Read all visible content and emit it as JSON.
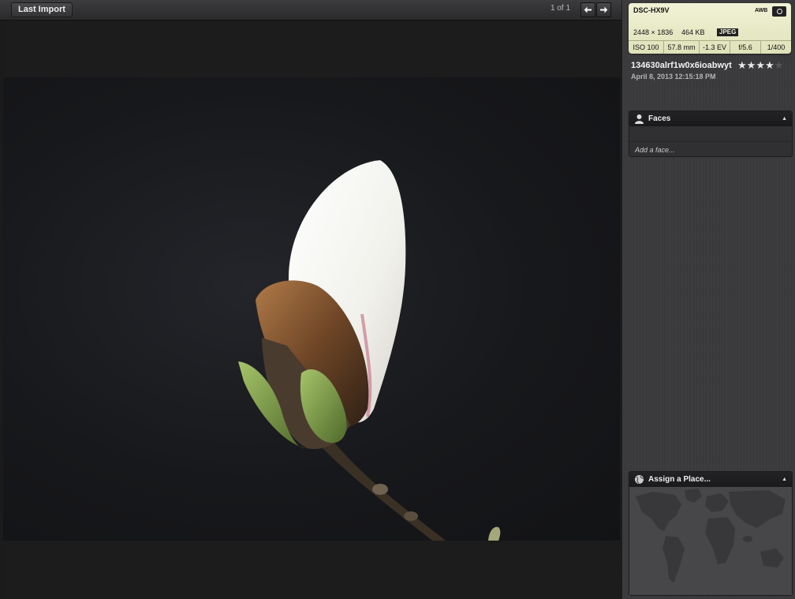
{
  "toolbar": {
    "back_label": "Last Import",
    "counter": "1 of 1",
    "prev_icon": "arrow-left-icon",
    "next_icon": "arrow-right-icon"
  },
  "info": {
    "camera_model": "DSC-HX9V",
    "white_balance": "AWB",
    "metering_icon": "metering-icon",
    "dimensions": "2448 × 1836",
    "file_size": "464 KB",
    "format": "JPEG",
    "iso": "ISO 100",
    "focal_length": "57.8 mm",
    "exposure_bias": "-1.3 EV",
    "aperture": "f/5.6",
    "shutter": "1/400"
  },
  "photo": {
    "title": "134630alrf1w0x6ioabwyt",
    "date": "April 8, 2013 12:15:18 PM",
    "rating": 4,
    "rating_max": 5,
    "star_glyph": "★"
  },
  "faces": {
    "header": "Faces",
    "placeholder": "Add a face...",
    "icon": "person-icon"
  },
  "places": {
    "header": "Assign a Place...",
    "icon": "globe-icon"
  },
  "colors": {
    "info_card_bg": "#eceecc",
    "sidebar_bg": "#3b3b3d",
    "viewer_bg": "#1c1c1d"
  }
}
